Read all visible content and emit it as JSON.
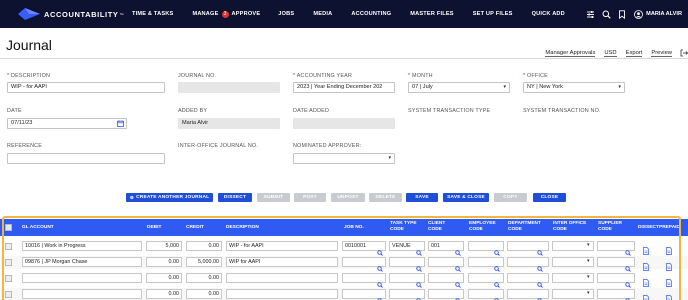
{
  "nav": {
    "brand": "ACCOUNTABILITY",
    "items": [
      "TIME & TASKS",
      "MANAGE",
      "APPROVE",
      "JOBS",
      "MEDIA",
      "ACCOUNTING",
      "MASTER FILES",
      "SET UP FILES",
      "QUICK ADD"
    ],
    "badge": "3",
    "user": "MARIA ALVIR"
  },
  "page": {
    "title": "Journal",
    "links": [
      "Manager Approvals",
      "USD",
      "Export",
      "Preview"
    ]
  },
  "form": {
    "description_label": "DESCRIPTION",
    "description_value": "WIP - for AAPI",
    "journal_no_label": "JOURNAL NO.",
    "accounting_year_label": "ACCOUNTING YEAR",
    "accounting_year_value": "2023 | Year Ending December 202",
    "month_label": "MONTH",
    "month_value": "07 | July",
    "office_label": "OFFICE",
    "office_value": "NY | New York",
    "date_label": "DATE",
    "date_value": "07/11/23",
    "added_by_label": "ADDED BY",
    "added_by_value": "Maria Alvir",
    "date_added_label": "DATE ADDED",
    "sys_type_label": "SYSTEM TRANSACTION TYPE",
    "sys_no_label": "SYSTEM TRANSACTION NO.",
    "reference_label": "REFERENCE",
    "inter_office_label": "INTER-OFFICE JOURNAL NO.",
    "nominated_label": "NOMINATED APPROVER:"
  },
  "toolbar": {
    "create": "CREATE ANOTHER JOURNAL",
    "dissect": "DISSECT",
    "submit": "SUBMIT",
    "post": "POST",
    "unpost": "UNPOST",
    "delete": "DELETE",
    "save": "SAVE",
    "save_close": "SAVE & CLOSE",
    "copy": "COPY",
    "close": "CLOSE"
  },
  "grid": {
    "headers": {
      "gl": "GL ACCOUNT",
      "debit": "DEBIT",
      "credit": "CREDIT",
      "description": "DESCRIPTION",
      "job": "JOB NO.",
      "task1": "TASK TYPE",
      "task2": "CODE",
      "client1": "CLIENT",
      "client2": "CODE",
      "employee1": "EMPLOYEE",
      "employee2": "CODE",
      "department1": "DEPARTMENT",
      "department2": "CODE",
      "inter1": "INTER OFFICE",
      "inter2": "CODE",
      "supplier1": "SUPPLIER",
      "supplier2": "CODE",
      "dissect": "DISSECT",
      "prepaid": "PREPAID"
    },
    "rows": [
      {
        "gl": "10016 | Work in Progress",
        "debit": "5,000",
        "credit": "0.00",
        "description": "WIP - for AAPI",
        "job": "0010001",
        "task": "VENUE",
        "client": "001"
      },
      {
        "gl": "09876 | JP Morgan Chase",
        "debit": "0.00",
        "credit": "5,000.00",
        "description": "WIP for AAPI",
        "job": "",
        "task": "",
        "client": ""
      },
      {
        "gl": "",
        "debit": "0.00",
        "credit": "0.00",
        "description": "",
        "job": "",
        "task": "",
        "client": ""
      },
      {
        "gl": "",
        "debit": "0.00",
        "credit": "0.00",
        "description": "",
        "job": "",
        "task": "",
        "client": ""
      }
    ]
  },
  "colors": {
    "nav_bg": "#0c1230",
    "accent_blue": "#1f4fd8",
    "grid_header": "#2f5bf2",
    "highlight": "#f2b63a"
  }
}
